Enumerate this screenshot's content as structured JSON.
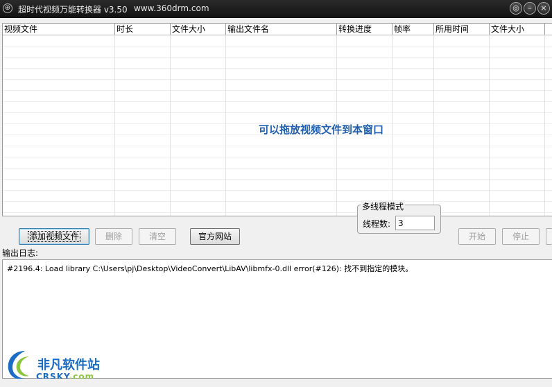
{
  "window": {
    "title": "超时代视频万能转换器 v3.50",
    "url": "www.360drm.com",
    "controls": {
      "menu": "◎",
      "minimize": "–",
      "close": "×"
    }
  },
  "file_list": {
    "columns": [
      "视频文件",
      "时长",
      "文件大小",
      "输出文件名",
      "转换进度",
      "帧率",
      "所用时间",
      "文件大小"
    ],
    "drop_hint": "可以拖放视频文件到本窗口",
    "rows": []
  },
  "threads": {
    "group_title": "多线程模式",
    "label": "线程数:",
    "value": "3"
  },
  "buttons": {
    "add": "添加视频文件",
    "delete": "删除",
    "clear": "清空",
    "website": "官方网站",
    "start": "开始",
    "stop": "停止"
  },
  "log": {
    "label": "输出日志:",
    "lines": [
      "#2196.4: Load library C:\\Users\\pj\\Desktop\\VideoConvert\\LibAV\\libmfx-0.dll error(#126): 找不到指定的模块。"
    ]
  },
  "watermark": {
    "line1": "非凡软件站",
    "line2a": "CRSKY",
    "line2b": ".com"
  },
  "colors": {
    "titlebar": "#1a1a1a",
    "drop_hint": "#1f5fae",
    "watermark_blue": "#1b6cc4",
    "watermark_green": "#8cc63f"
  }
}
